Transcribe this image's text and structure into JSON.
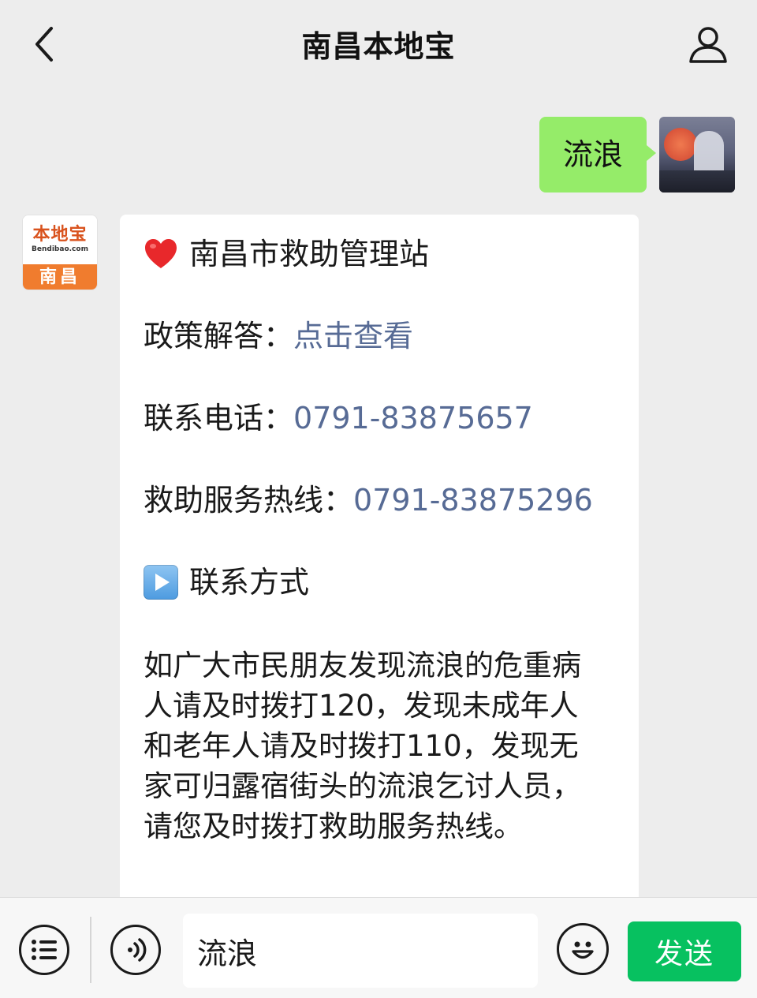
{
  "header": {
    "title": "南昌本地宝",
    "back_icon": "chevron-left-icon",
    "profile_icon": "user-profile-icon"
  },
  "outgoing_message": {
    "text": "流浪"
  },
  "bot": {
    "avatar_logo": "本地宝",
    "avatar_sub": "Bendibao.com",
    "avatar_city": "南昌"
  },
  "incoming_message": {
    "title_emoji": "red-heart-icon",
    "title": "南昌市救助管理站",
    "policy_label": "政策解答：",
    "policy_link": "点击查看",
    "phone_label": "联系电话：",
    "phone_value": "0791-83875657",
    "hotline_label": "救助服务热线：",
    "hotline_value": "0791-83875296",
    "contact_icon": "play-button-icon",
    "contact_heading": "联系方式",
    "paragraph": "如广大市民朋友发现流浪的危重病\n人请及时拨打120，发现未成年人\n和老年人请及时拨打110，发现无\n家可归露宿街头的流浪乞讨人员，\n请您及时拨打救助服务热线。"
  },
  "input_bar": {
    "menu_icon": "menu-list-icon",
    "voice_icon": "voice-icon",
    "input_value": "流浪",
    "emoji_icon": "emoji-icon",
    "send_label": "发送"
  },
  "colors": {
    "background": "#ededed",
    "outgoing_bubble": "#95ec69",
    "link": "#576b95",
    "send_button": "#07c160",
    "brand_orange": "#f07c2e"
  }
}
